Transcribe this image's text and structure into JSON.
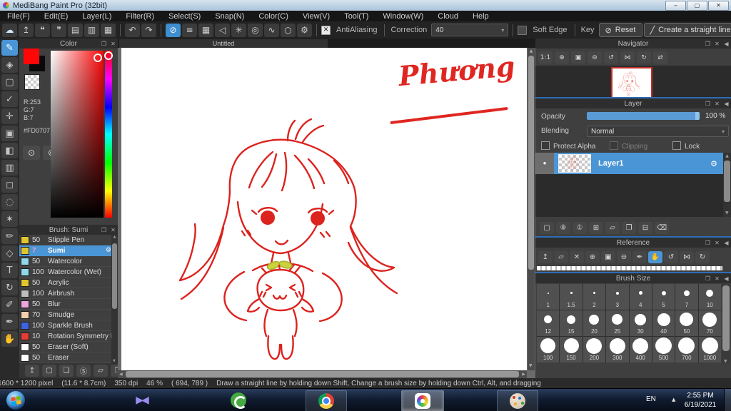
{
  "ui": {
    "popout": "❐",
    "close": "✕",
    "collapse": "◀",
    "caret": "▾",
    "minimize": "‒",
    "maximize": "▢",
    "up": "▲",
    "down": "▼",
    "left": "◀",
    "right": "▶"
  },
  "window": {
    "title": "MediBang Paint Pro (32bit)"
  },
  "menubar": {
    "items": [
      {
        "name": "menu-file",
        "label": "File(F)"
      },
      {
        "name": "menu-edit",
        "label": "Edit(E)"
      },
      {
        "name": "menu-layer",
        "label": "Layer(L)"
      },
      {
        "name": "menu-filter",
        "label": "Filter(R)"
      },
      {
        "name": "menu-select",
        "label": "Select(S)"
      },
      {
        "name": "menu-snap",
        "label": "Snap(N)"
      },
      {
        "name": "menu-color",
        "label": "Color(C)"
      },
      {
        "name": "menu-view",
        "label": "View(V)"
      },
      {
        "name": "menu-tool",
        "label": "Tool(T)"
      },
      {
        "name": "menu-window",
        "label": "Window(W)"
      },
      {
        "name": "menu-cloud",
        "label": "Cloud"
      },
      {
        "name": "menu-help",
        "label": "Help"
      }
    ]
  },
  "toolbar": {
    "file_icons": [
      {
        "name": "cloud-icon",
        "glyph": "☁",
        "state": "accent"
      },
      {
        "name": "publish-icon",
        "glyph": "↥"
      },
      {
        "name": "comment-icon",
        "glyph": "❝"
      },
      {
        "name": "comment-outline-icon",
        "glyph": "❞"
      },
      {
        "name": "document-icon",
        "glyph": "▤"
      },
      {
        "name": "form-icon",
        "glyph": "▥"
      },
      {
        "name": "grid-view-icon",
        "glyph": "▦"
      }
    ],
    "history_icons": [
      {
        "name": "undo-icon",
        "glyph": "↶"
      },
      {
        "name": "redo-icon",
        "glyph": "↷"
      }
    ],
    "snap_icons": [
      {
        "name": "snap-off-icon",
        "glyph": "⊘",
        "state": "selected"
      },
      {
        "name": "snap-parallel-icon",
        "glyph": "≡"
      },
      {
        "name": "snap-grid-icon",
        "glyph": "▦"
      },
      {
        "name": "snap-vanishing-icon",
        "glyph": "◁"
      },
      {
        "name": "snap-radial-icon",
        "glyph": "✳"
      },
      {
        "name": "snap-concentric-icon",
        "glyph": "◎"
      },
      {
        "name": "snap-curve-icon",
        "glyph": "∿"
      },
      {
        "name": "snap-ellipse-icon",
        "glyph": "○"
      },
      {
        "name": "snap-settings-icon",
        "glyph": "⚙"
      }
    ],
    "antialiasing_label": "AntiAliasing",
    "check_glyph": "✕",
    "correction_label": "Correction",
    "correction_value": "40",
    "soft_edge_label": "Soft Edge",
    "key_label": "Key",
    "reset_icon": "⊘",
    "reset_label": "Reset",
    "line_icon": "╱",
    "straight_line_label": "Create a straight line"
  },
  "tool_strip": {
    "tools": [
      {
        "name": "brush-tool",
        "glyph": "✎",
        "state": "selected"
      },
      {
        "name": "eraser-tool",
        "glyph": "◈"
      },
      {
        "name": "square-tool",
        "glyph": "▢"
      },
      {
        "name": "polyline-tool",
        "glyph": "✓"
      },
      {
        "name": "move-tool",
        "glyph": "✛"
      },
      {
        "name": "select-tool",
        "glyph": "▣"
      },
      {
        "name": "bucket-tool",
        "glyph": "◧"
      },
      {
        "name": "gradient-tool",
        "glyph": "▥"
      },
      {
        "name": "select-rect-tool",
        "glyph": "◻"
      },
      {
        "name": "lasso-tool",
        "glyph": "◌"
      },
      {
        "name": "magic-wand-tool",
        "glyph": "✶"
      },
      {
        "name": "select-pen-tool",
        "glyph": "✏"
      },
      {
        "name": "select-eraser-tool",
        "glyph": "◇"
      },
      {
        "name": "text-tool",
        "glyph": "T"
      },
      {
        "name": "rotate-view-tool",
        "glyph": "↻"
      },
      {
        "name": "eraser-pen-tool",
        "glyph": "✐"
      },
      {
        "name": "eyedropper-tool",
        "glyph": "✒"
      },
      {
        "name": "hand-tool",
        "glyph": "✋"
      }
    ]
  },
  "color_panel": {
    "title": "Color",
    "r": "R:253",
    "g": "G:7",
    "b": "B:7",
    "hex": "#FD0707",
    "fg_color": "#fd0707",
    "palette_icons": [
      {
        "name": "palette-icon",
        "glyph": "⊙"
      },
      {
        "name": "palette-set-icon",
        "glyph": "⊚"
      }
    ]
  },
  "brush_panel": {
    "title": "Brush: Sumi",
    "brushes": [
      {
        "swatch": "#e0c62e",
        "size": "50",
        "name": "Stipple Pen"
      },
      {
        "swatch": "#e0c62e",
        "size": "7",
        "name": "Sumi",
        "state": "selected",
        "size_color": "#f59ad0",
        "gear": "⚙"
      },
      {
        "swatch": "#8fd8e8",
        "size": "50",
        "name": "Watercolor"
      },
      {
        "swatch": "#8fd8e8",
        "size": "100",
        "name": "Watercolor (Wet)"
      },
      {
        "swatch": "#e0c62e",
        "size": "50",
        "name": "Acrylic"
      },
      {
        "swatch": "#bdbdbd",
        "size": "100",
        "name": "Airbrush"
      },
      {
        "swatch": "#eba6e0",
        "size": "50",
        "name": "Blur"
      },
      {
        "swatch": "#f2cfae",
        "size": "70",
        "name": "Smudge"
      },
      {
        "swatch": "#3f63e0",
        "size": "100",
        "name": "Sparkle Brush"
      },
      {
        "swatch": "#e83b33",
        "size": "10",
        "name": "Rotation Symmetry P"
      },
      {
        "swatch": "#ffffff",
        "size": "50",
        "name": "Eraser (Soft)"
      },
      {
        "swatch": "#ffffff",
        "size": "50",
        "name": "Eraser"
      }
    ],
    "footer_icons": [
      {
        "name": "brush-cloud-icon",
        "glyph": "↥"
      },
      {
        "name": "brush-new-icon",
        "glyph": "▢"
      },
      {
        "name": "brush-add-image-icon",
        "glyph": "❏"
      },
      {
        "name": "brush-script-icon",
        "glyph": "Ⓢ"
      },
      {
        "name": "brush-folder-icon",
        "glyph": "▱"
      },
      {
        "name": "brush-duplicate-icon",
        "glyph": "❐"
      }
    ]
  },
  "canvas": {
    "tab": "Untitled",
    "signature": "Phương"
  },
  "navigator": {
    "title": "Navigator",
    "buttons": [
      {
        "name": "zoom-actual-icon",
        "glyph": "1:1"
      },
      {
        "name": "zoom-in-icon",
        "glyph": "⊕"
      },
      {
        "name": "fit-window-icon",
        "glyph": "▣"
      },
      {
        "name": "zoom-out-icon",
        "glyph": "⊖"
      },
      {
        "name": "rotate-left-icon",
        "glyph": "↺"
      },
      {
        "name": "rotate-reset-icon",
        "glyph": "⋈"
      },
      {
        "name": "rotate-right-icon",
        "glyph": "↻"
      },
      {
        "name": "flip-icon",
        "glyph": "⇄"
      }
    ]
  },
  "layer_panel": {
    "title": "Layer",
    "opacity_label": "Opacity",
    "opacity_value": "100 %",
    "blending_label": "Blending",
    "blending_value": "Normal",
    "protect_alpha": "Protect Alpha",
    "clipping": "Clipping",
    "lock": "Lock",
    "layer_name": "Layer1",
    "gear": "⚙",
    "visible_dot": "●",
    "footer_icons": [
      {
        "name": "new-layer-icon",
        "glyph": "▢"
      },
      {
        "name": "new-8bit-layer-icon",
        "glyph": "⑧"
      },
      {
        "name": "new-1bit-layer-icon",
        "glyph": "①"
      },
      {
        "name": "add-layer-menu-icon",
        "glyph": "⊞"
      },
      {
        "name": "new-folder-icon",
        "glyph": "▱"
      },
      {
        "name": "duplicate-layer-icon",
        "glyph": "❐"
      },
      {
        "name": "merge-layer-icon",
        "glyph": "⊟"
      },
      {
        "name": "delete-layer-icon",
        "glyph": "⌫"
      }
    ]
  },
  "reference": {
    "title": "Reference",
    "buttons": [
      {
        "name": "ref-cloud-icon",
        "glyph": "↥"
      },
      {
        "name": "ref-open-icon",
        "glyph": "▱"
      },
      {
        "name": "ref-clear-icon",
        "glyph": "✕"
      },
      {
        "name": "ref-zoom-in-icon",
        "glyph": "⊕"
      },
      {
        "name": "ref-fit-icon",
        "glyph": "▣"
      },
      {
        "name": "ref-zoom-out-icon",
        "glyph": "⊖"
      },
      {
        "name": "ref-eyedropper-icon",
        "glyph": "✒"
      },
      {
        "name": "ref-hand-icon",
        "glyph": "✋",
        "state": "selected"
      },
      {
        "name": "ref-rotate-left-icon",
        "glyph": "↺"
      },
      {
        "name": "ref-rotate-reset-icon",
        "glyph": "⋈"
      },
      {
        "name": "ref-rotate-right-icon",
        "glyph": "↻"
      }
    ]
  },
  "brush_size": {
    "title": "Brush Size",
    "sizes": [
      {
        "label": "1",
        "dot": "2px"
      },
      {
        "label": "1.5",
        "dot": "3px"
      },
      {
        "label": "2",
        "dot": "3px"
      },
      {
        "label": "3",
        "dot": "4px"
      },
      {
        "label": "4",
        "dot": "5px"
      },
      {
        "label": "5",
        "dot": "6px"
      },
      {
        "label": "7",
        "dot": "8px"
      },
      {
        "label": "10",
        "dot": "10px"
      },
      {
        "label": "12",
        "dot": "11px"
      },
      {
        "label": "15",
        "dot": "12px"
      },
      {
        "label": "20",
        "dot": "14px"
      },
      {
        "label": "25",
        "dot": "15px"
      },
      {
        "label": "30",
        "dot": "16px"
      },
      {
        "label": "40",
        "dot": "18px"
      },
      {
        "label": "50",
        "dot": "19px"
      },
      {
        "label": "70",
        "dot": "20px"
      },
      {
        "label": "100",
        "dot": "21px"
      },
      {
        "label": "150",
        "dot": "21px"
      },
      {
        "label": "200",
        "dot": "22px"
      },
      {
        "label": "300",
        "dot": "22px"
      },
      {
        "label": "400",
        "dot": "22px"
      },
      {
        "label": "500",
        "dot": "23px"
      },
      {
        "label": "700",
        "dot": "23px"
      },
      {
        "label": "1000",
        "dot": "23px"
      }
    ]
  },
  "statusbar": {
    "size": "1600 * 1200 pixel",
    "dims": "(11.6 * 8.7cm)",
    "dpi": "350 dpi",
    "zoom": "46 %",
    "coords": "( 694, 789 )",
    "hint": "Draw a straight line by holding down Shift, Change a brush size by holding down Ctrl, Alt, and dragging"
  },
  "taskbar": {
    "lang": "EN",
    "tray_arrow": "▲",
    "time": "2:55 PM",
    "date": "6/19/2021"
  }
}
